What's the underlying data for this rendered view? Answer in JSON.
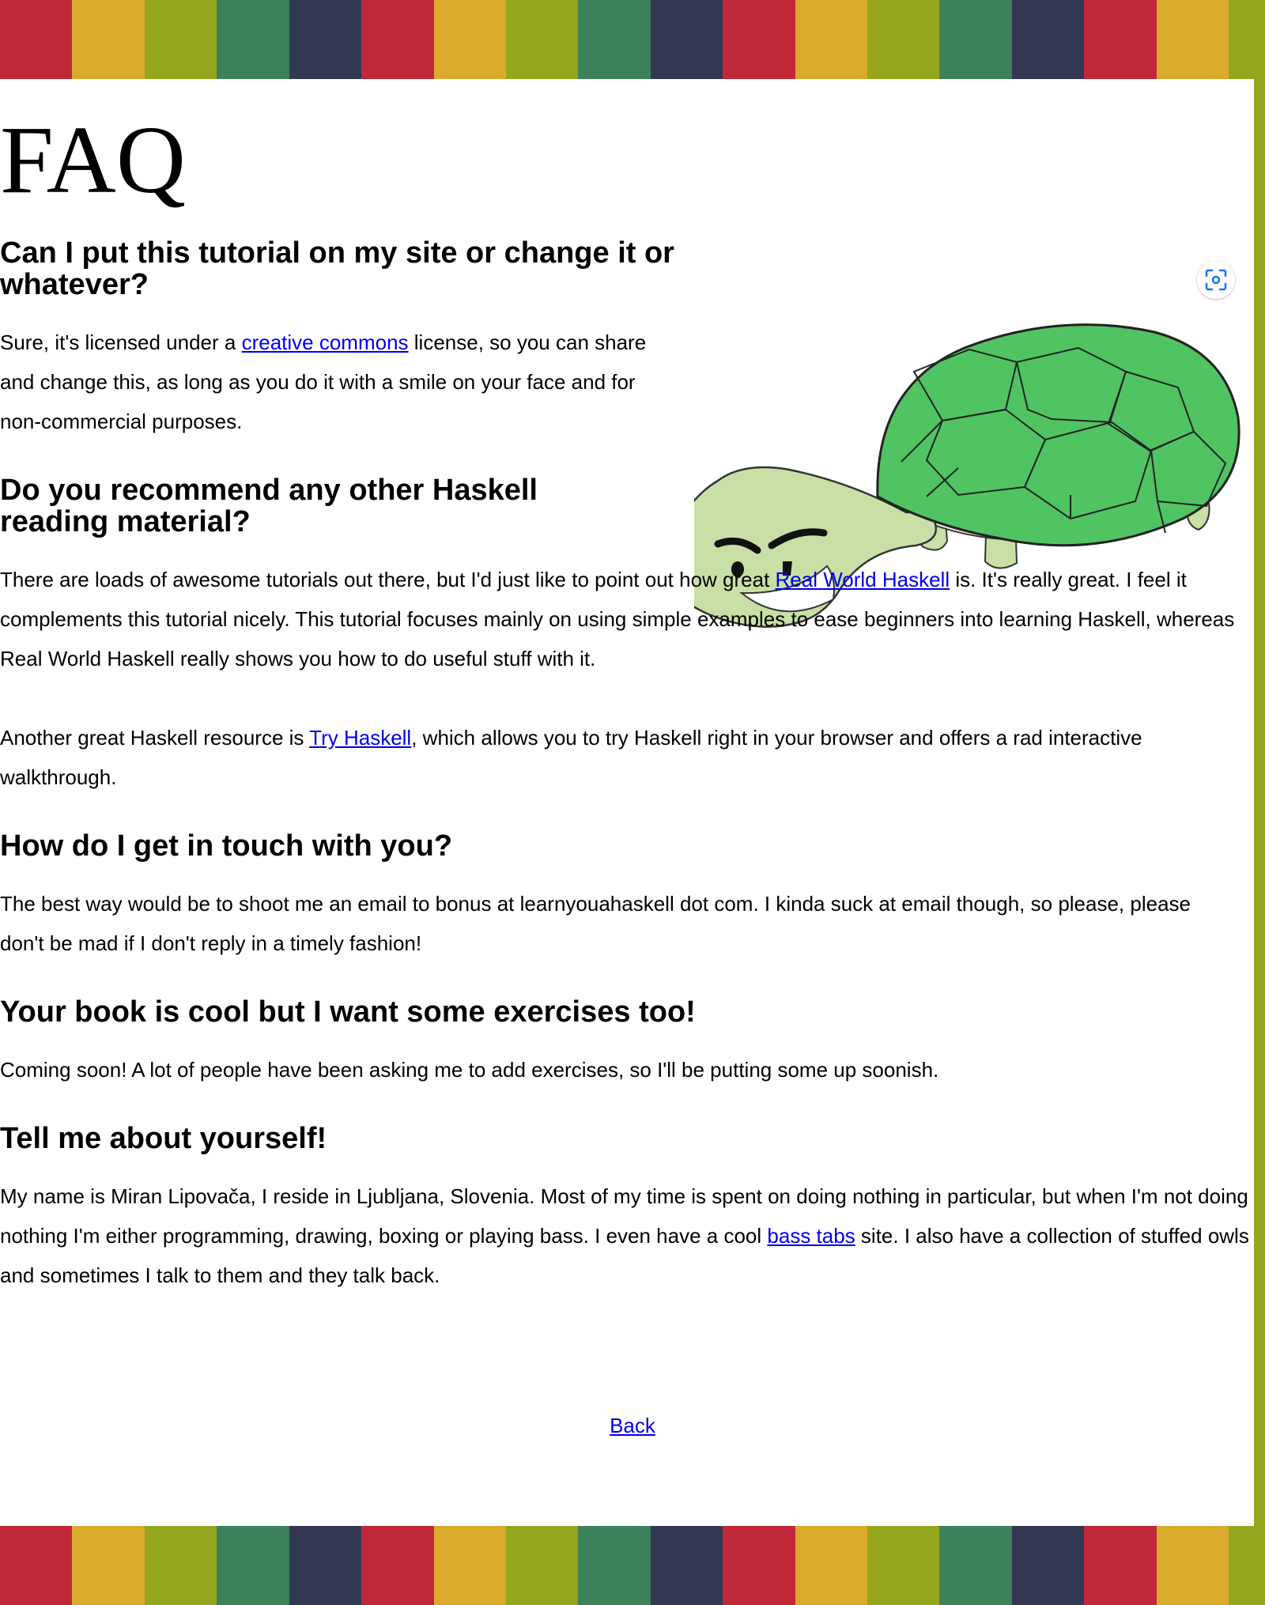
{
  "colors": {
    "stripes": [
      "#c0283a",
      "#d9aa2c",
      "#94a51e",
      "#3c8159",
      "#323752",
      "#c0283a",
      "#d9aa2c",
      "#94a51e",
      "#3c8159",
      "#323752",
      "#c0283a",
      "#d9aa2c",
      "#94a51e",
      "#3c8159",
      "#323752",
      "#c0283a",
      "#d9aa2c",
      "#94a51e"
    ],
    "link": "#0000ee",
    "turtle_shell": "#50c463",
    "turtle_skin": "#c8e0a6"
  },
  "page_title": "FAQ",
  "faq": [
    {
      "question": "Can I put this tutorial on my site or change it or whatever?",
      "answer": {
        "before": "Sure, it's licensed under a ",
        "link": "creative commons",
        "after": " license, so you can share and change this, as long as you do it with a smile on your face and for non-commercial purposes."
      }
    },
    {
      "question": "Do you recommend any other Haskell reading material?",
      "answer": {
        "before": "There are loads of awesome tutorials out there, but I'd just like to point out how great ",
        "link": "Real World Haskell",
        "after": " is. It's really great. I feel it complements this tutorial nicely. This tutorial focuses mainly on using simple examples to ease beginners into learning Haskell, whereas Real World Haskell really shows you how to do useful stuff with it."
      },
      "answer2": {
        "before": "Another great Haskell resource is ",
        "link": "Try Haskell",
        "after": ", which allows you to try Haskell right in your browser and offers a rad interactive walkthrough."
      }
    },
    {
      "question": "How do I get in touch with you?",
      "answer": {
        "text": "The best way would be to shoot me an email to bonus at learnyouahaskell dot com. I kinda suck at email though, so please, please don't be mad if I don't reply in a timely fashion!"
      }
    },
    {
      "question": "Your book is cool but I want some exercises too!",
      "answer": {
        "text": "Coming soon! A lot of people have been asking me to add exercises, so I'll be putting some up soonish."
      }
    },
    {
      "question": "Tell me about yourself!",
      "answer": {
        "before": "My name is Miran Lipovača, I reside in Ljubljana, Slovenia. Most of my time is spent on doing nothing in particular, but when I'm not doing nothing I'm either programming, drawing, boxing or playing bass. I even have a cool ",
        "link": "bass tabs",
        "after": " site. I also have a collection of stuffed owls and sometimes I talk to them and they talk back."
      }
    }
  ],
  "back_link": "Back",
  "icons": {
    "turtle": "turtle-illustration",
    "scan": "visual-search-icon"
  }
}
